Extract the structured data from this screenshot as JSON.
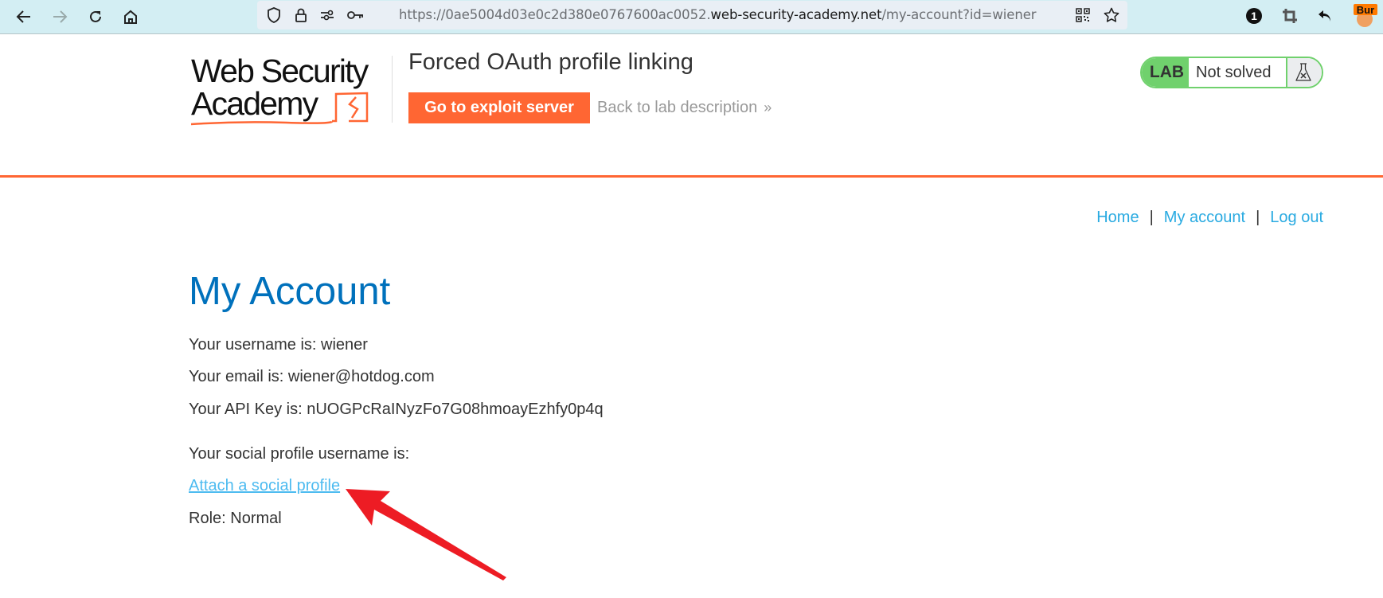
{
  "browser": {
    "url_prefix": "https://0ae5004d03e0c2d380e0767600ac0052.",
    "url_host": "web-security-academy.net",
    "url_path": "/my-account?id=wiener",
    "extension_badge": "1",
    "burp_label": "Bur",
    "icons": [
      "back-arrow",
      "forward-arrow",
      "reload",
      "home",
      "shield",
      "lock",
      "permissions",
      "key",
      "qr-code",
      "bookmark-star",
      "notification-badge",
      "crop",
      "undo",
      "burp-extension"
    ]
  },
  "header": {
    "logo_line1": "Web Security",
    "logo_line2": "Academy",
    "lab_title": "Forced OAuth profile linking",
    "exploit_button": "Go to exploit server",
    "back_link": "Back to lab description",
    "back_chevron": "»",
    "lab_badge": {
      "tag": "LAB",
      "status": "Not solved",
      "icon": "flask-icon",
      "color": "#70d16d"
    }
  },
  "nav": {
    "items": [
      "Home",
      "My account",
      "Log out"
    ],
    "separator": "|"
  },
  "account": {
    "title": "My Account",
    "username_line": "Your username is: wiener",
    "email_line": "Your email is: wiener@hotdog.com",
    "api_key_line": "Your API Key is: nUOGPcRaINyzFo7G08hmoayEzhfy0p4q",
    "social_line": "Your social profile username is:",
    "attach_link": "Attach a social profile",
    "role_line": "Role: Normal"
  },
  "colors": {
    "accent_orange": "#ff6633",
    "title_blue": "#0071bc",
    "link_blue": "#29aae1",
    "annotation_red": "#ed1c24"
  }
}
